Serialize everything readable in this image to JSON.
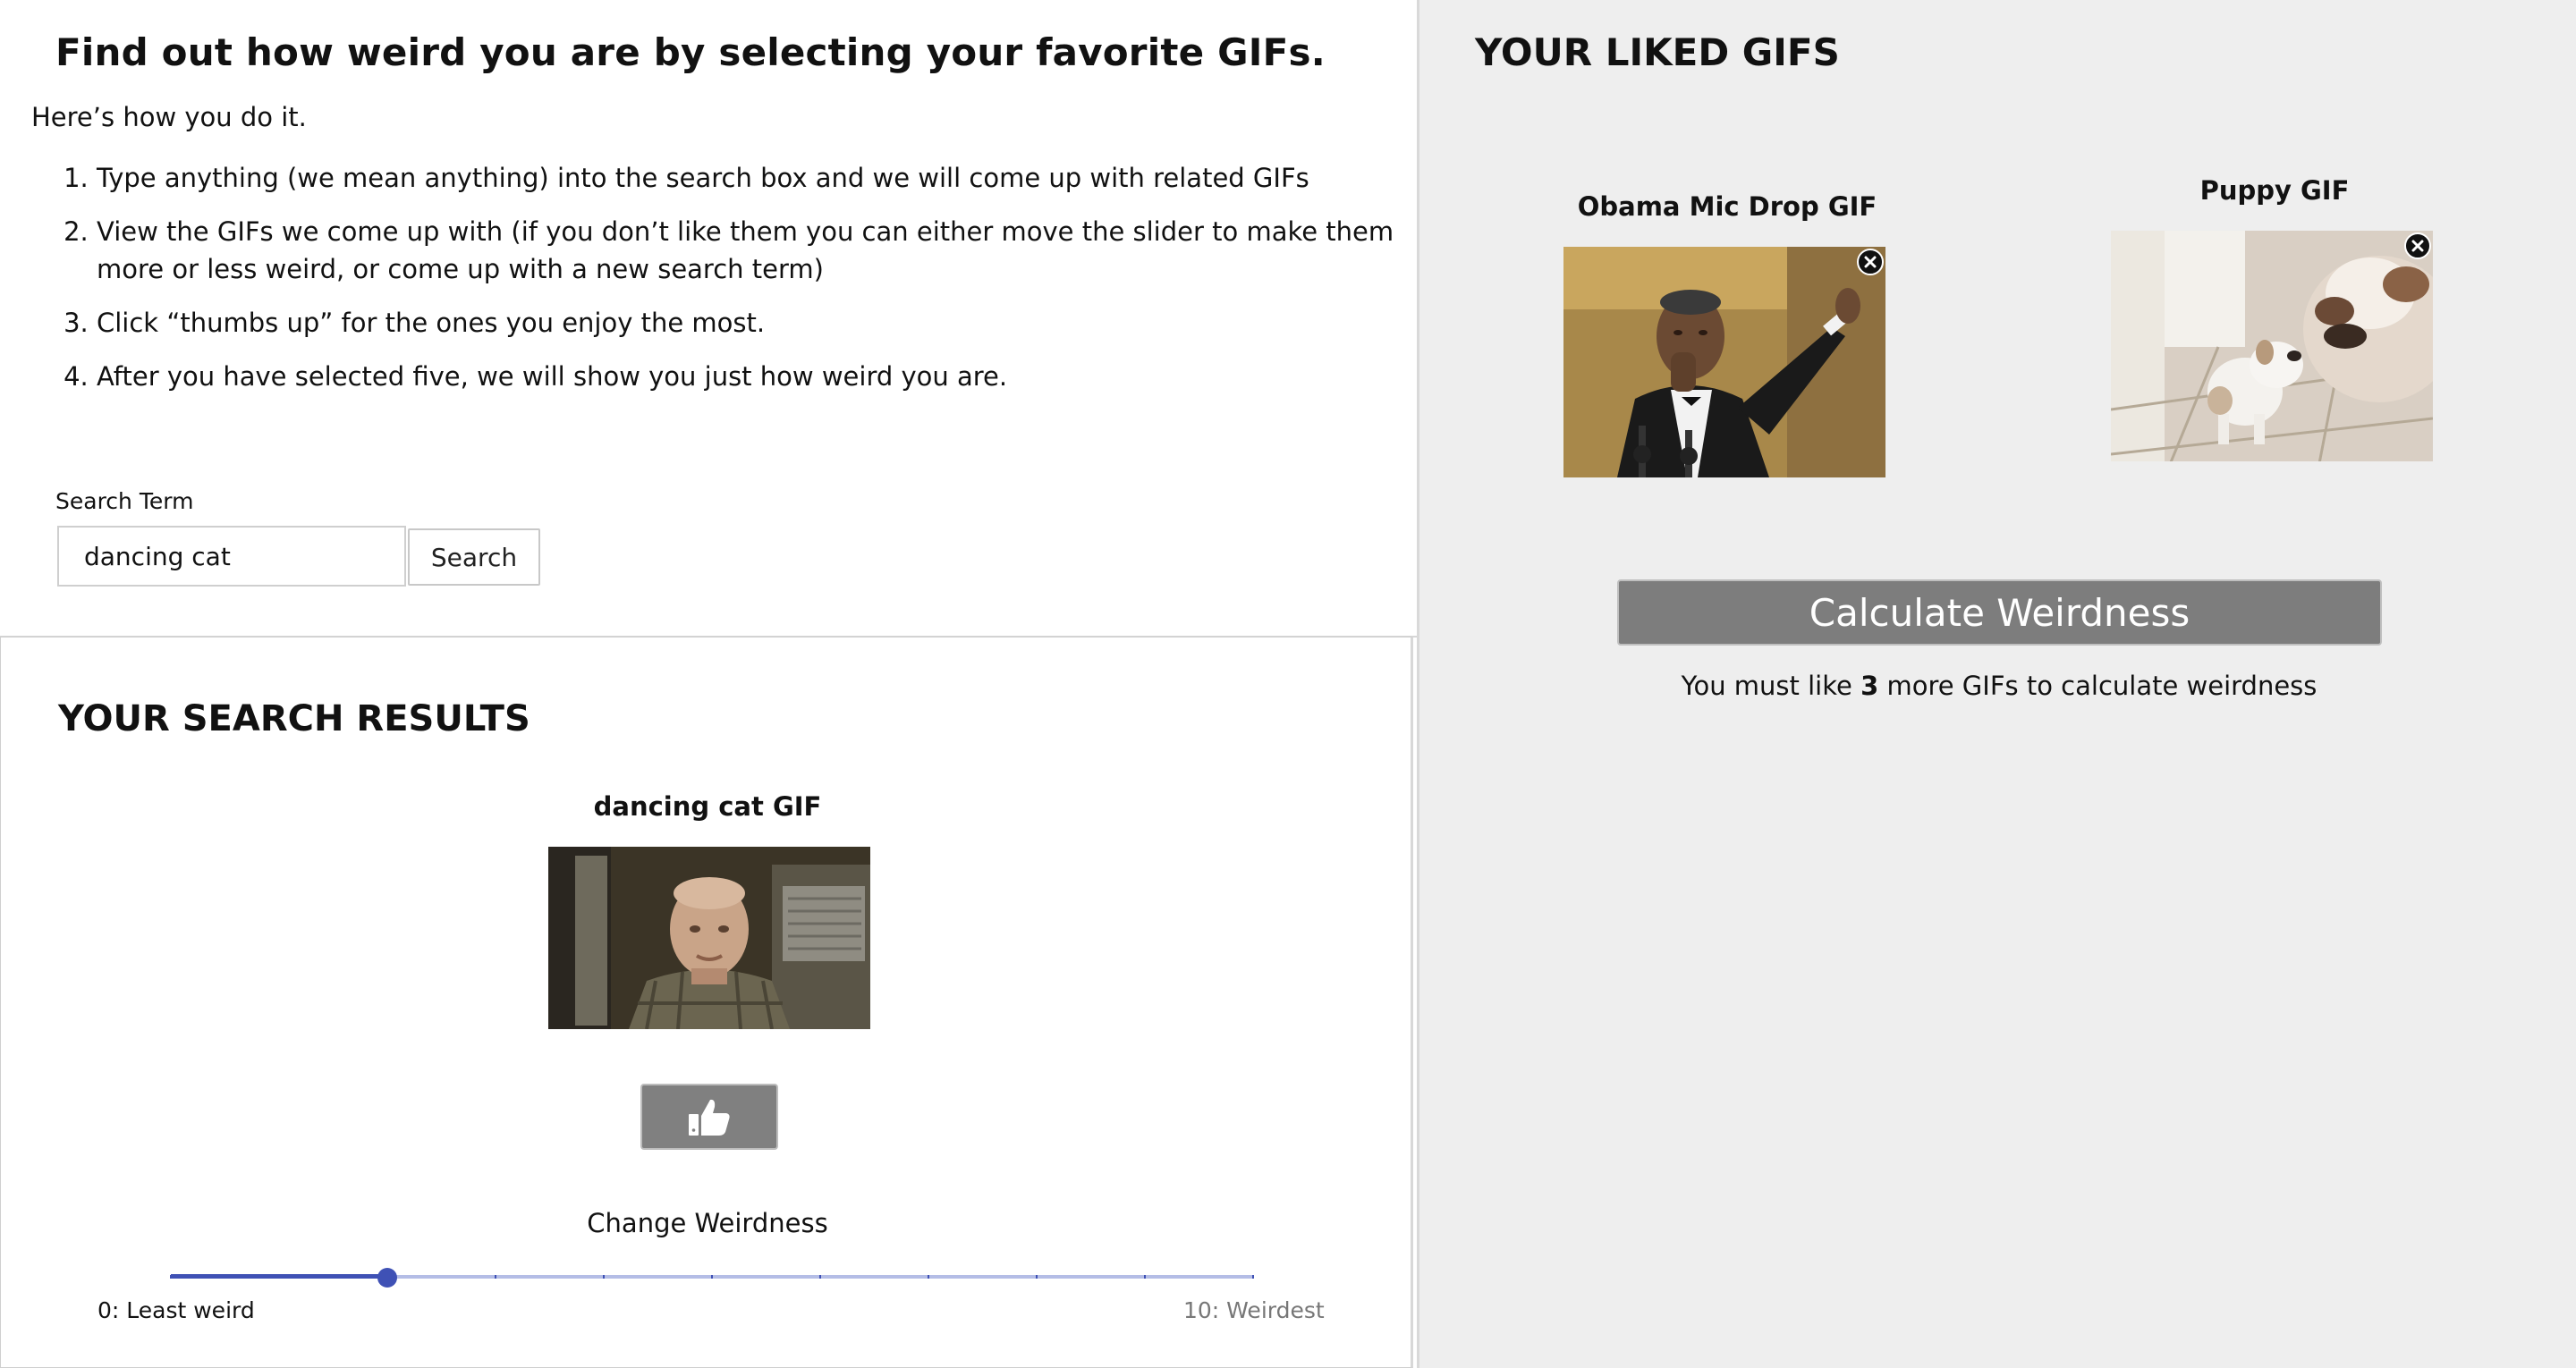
{
  "intro": {
    "headline": "Find out how weird you are by selecting your favorite GIFs.",
    "lead": "Here’s how you do it.",
    "steps": [
      "Type anything (we mean anything) into the search box and we will come up with related GIFs",
      "View the GIFs we come up with (if you don’t like them you can either move the slider to make them more or less weird, or come up with a new search term)",
      "Click “thumbs up” for the ones you enjoy the most.",
      "After you have selected five, we will show you just how weird you are."
    ]
  },
  "search": {
    "label": "Search Term",
    "value": "dancing cat",
    "button_label": "Search"
  },
  "results": {
    "title": "YOUR SEARCH RESULTS",
    "caption": "dancing cat GIF",
    "like_icon": "thumbs-up-icon",
    "weirdness_label": "Change Weirdness",
    "slider": {
      "min": 0,
      "max": 10,
      "value": 2,
      "min_label": "0: Least weird",
      "max_label": "10: Weirdest"
    }
  },
  "liked": {
    "title": "YOUR LIKED GIFS",
    "items": [
      {
        "caption": "Obama Mic Drop GIF",
        "remove_icon": "close-circle-icon"
      },
      {
        "caption": "Puppy GIF",
        "remove_icon": "close-circle-icon"
      }
    ],
    "calculate_label": "Calculate Weirdness",
    "notice_prefix": "You must like",
    "remaining": "3",
    "notice_suffix": "more GIFs to calculate weirdness"
  },
  "colors": {
    "accent": "#3f51b5",
    "panel_bg": "#eeeeee",
    "button_gray": "#808080"
  }
}
